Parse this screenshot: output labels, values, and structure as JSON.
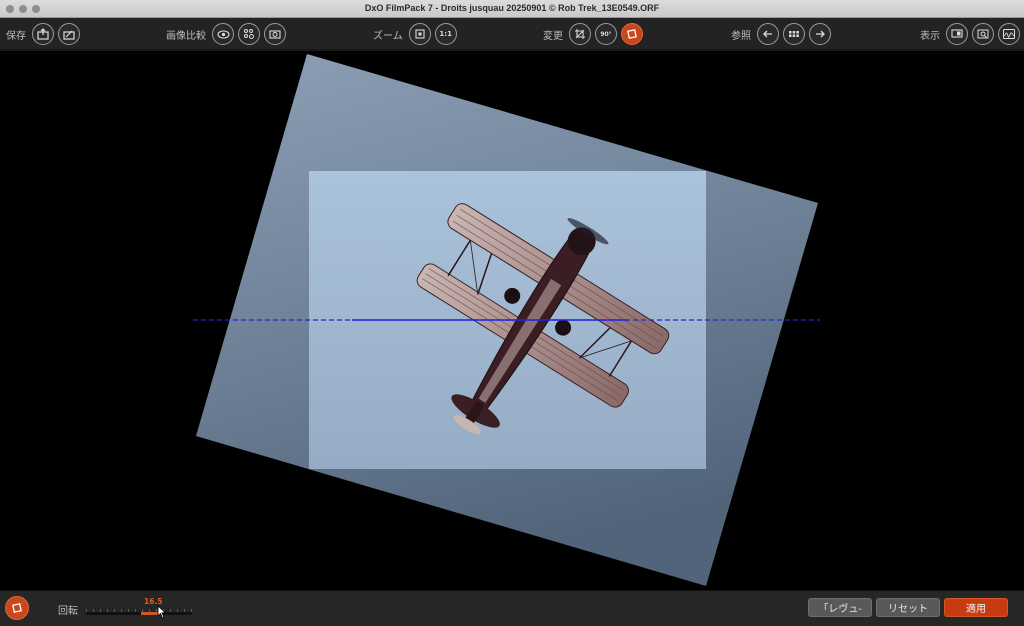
{
  "window": {
    "title": "DxO FilmPack 7 - Droits jusquau 20250901 © Rob Trek_13E0549.ORF"
  },
  "toolbar": {
    "save_label": "保存",
    "compare_label": "画像比較",
    "zoom_label": "ズーム",
    "zoom_one_label": "1:1",
    "transform_label": "変更",
    "rotate90_label": "90°",
    "browse_label": "参照",
    "display_label": "表示"
  },
  "straighten": {
    "rotation_label": "回転",
    "rotation_value": "16.5"
  },
  "actions": {
    "preview_label": "「レヴュ-",
    "reset_label": "リセット",
    "apply_label": "適用"
  },
  "colors": {
    "accent": "#c9471d",
    "guide_line": "#2323e6"
  }
}
